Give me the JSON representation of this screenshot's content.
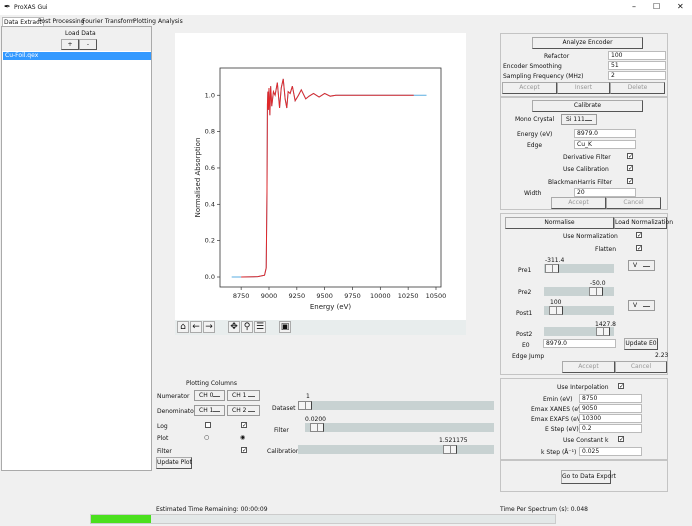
{
  "window": {
    "title": "ProXAS Gui",
    "minimize": "–",
    "maximize": "☐",
    "close": "✕"
  },
  "tabs": [
    {
      "label": "Data Extract"
    },
    {
      "label": "Post Processing"
    },
    {
      "label": "Fourier Transform"
    },
    {
      "label": "Plotting"
    },
    {
      "label": "Analysis"
    }
  ],
  "load": {
    "title": "Load Data",
    "add": "+",
    "remove": "-",
    "files": [
      "Cu-Foil.qex"
    ]
  },
  "toolbar": {
    "icons": [
      "home-icon",
      "back-icon",
      "forward-icon",
      "pan-icon",
      "zoom-icon",
      "configure-icon",
      "save-icon"
    ]
  },
  "chart_data": {
    "type": "line",
    "xlabel": "Energy (eV)",
    "ylabel": "Normalised Absorption",
    "xlim": [
      8560,
      10545
    ],
    "ylim": [
      -0.055,
      1.15
    ],
    "xticks": [
      8750,
      9000,
      9250,
      9500,
      9750,
      10000,
      10250,
      10500
    ],
    "yticks": [
      0.0,
      0.2,
      0.4,
      0.6,
      0.8,
      1.0
    ],
    "series": [
      {
        "color": "#5aaee0",
        "points": [
          [
            8665,
            0
          ],
          [
            8750,
            0
          ],
          [
            8900,
            0.002
          ],
          [
            8960,
            0.01
          ],
          [
            8975,
            0.05
          ],
          [
            8982,
            0.47
          ],
          [
            8986,
            0.95
          ],
          [
            8990,
            1.02
          ],
          [
            8995,
            0.92
          ],
          [
            9000,
            1.04
          ],
          [
            9008,
            0.89
          ],
          [
            9015,
            1.05
          ],
          [
            9025,
            0.94
          ],
          [
            9040,
            1.02
          ],
          [
            9055,
            1.0
          ],
          [
            9075,
            1.07
          ],
          [
            9095,
            0.93
          ],
          [
            9110,
            1.04
          ],
          [
            9128,
            1.09
          ],
          [
            9145,
            0.98
          ],
          [
            9160,
            0.93
          ],
          [
            9172,
            1.02
          ],
          [
            9190,
            1.01
          ],
          [
            9210,
            1.05
          ],
          [
            9235,
            0.97
          ],
          [
            9265,
            1.0
          ],
          [
            9290,
            1.03
          ],
          [
            9330,
            0.98
          ],
          [
            9360,
            0.995
          ],
          [
            9400,
            1.01
          ],
          [
            9450,
            0.99
          ],
          [
            9500,
            1.01
          ],
          [
            9550,
            0.995
          ],
          [
            9600,
            1.0
          ],
          [
            10300,
            1.0
          ],
          [
            10415,
            1.0
          ]
        ]
      },
      {
        "color": "#e0282a",
        "points": [
          [
            8750,
            0
          ],
          [
            8900,
            0.002
          ],
          [
            8960,
            0.01
          ],
          [
            8975,
            0.05
          ],
          [
            8982,
            0.47
          ],
          [
            8986,
            0.95
          ],
          [
            8990,
            1.02
          ],
          [
            8995,
            0.92
          ],
          [
            9000,
            1.04
          ],
          [
            9008,
            0.89
          ],
          [
            9015,
            1.05
          ],
          [
            9025,
            0.94
          ],
          [
            9040,
            1.02
          ],
          [
            9055,
            1.0
          ],
          [
            9075,
            1.07
          ],
          [
            9095,
            0.93
          ],
          [
            9110,
            1.04
          ],
          [
            9128,
            1.09
          ],
          [
            9145,
            0.98
          ],
          [
            9160,
            0.93
          ],
          [
            9172,
            1.02
          ],
          [
            9190,
            1.01
          ],
          [
            9210,
            1.05
          ],
          [
            9235,
            0.97
          ],
          [
            9265,
            1.0
          ],
          [
            9290,
            1.03
          ],
          [
            9330,
            0.98
          ],
          [
            9360,
            0.995
          ],
          [
            9400,
            1.01
          ],
          [
            9450,
            0.99
          ],
          [
            9500,
            1.01
          ],
          [
            9550,
            0.995
          ],
          [
            9600,
            1.0
          ],
          [
            9800,
            1.0
          ],
          [
            10300,
            1.0
          ]
        ]
      }
    ]
  },
  "plotting": {
    "title": "Plotting Columns",
    "numerator": "Numerator",
    "denominator": "Denominator",
    "num_a": "CH 0",
    "num_b": "CH 1",
    "den_a": "CH 1",
    "den_b": "CH 2",
    "log": "Log",
    "plot": "Plot",
    "filter": "Filter",
    "update": "Update Plot",
    "log_a": false,
    "log_b": true,
    "plot_a": false,
    "plot_b": true,
    "filter_b": true
  },
  "sliders": {
    "dataset": {
      "label": "Dataset",
      "value": "1",
      "fraction": 0.0
    },
    "filter": {
      "label": "Filter",
      "value": "0.0200",
      "fraction": 0.03
    },
    "calibration": {
      "label": "Calibration",
      "value": "1.521175",
      "fraction": 0.76
    }
  },
  "encoder": {
    "button": "Analyze Encoder",
    "refactor_label": "Refactor",
    "refactor": "100",
    "smoothing_label": "Encoder Smoothing",
    "smoothing": "51",
    "freq_label": "Sampling Frequency (MHz)",
    "freq": "2",
    "accept": "Accept",
    "insert": "Insert",
    "delete": "Delete"
  },
  "calibrate": {
    "button": "Calibrate",
    "mono_label": "Mono Crystal",
    "mono": "Si 111",
    "energy_label": "Energy (eV)",
    "energy": "8979.0",
    "edge_label": "Edge",
    "edge": "Cu_K",
    "derivative": "Derivative Filter",
    "use_cal": "Use Calibration",
    "blackman": "BlackmanHarris Filter",
    "width_label": "Width",
    "width": "20",
    "accept": "Accept",
    "cancel": "Cancel"
  },
  "normalise": {
    "button": "Normalise",
    "load": "Load Normalization",
    "use_norm": "Use Normalization",
    "flatten": "Flatten",
    "pre1": "Pre1",
    "pre1_val": "-311.4",
    "pre2": "Pre2",
    "pre2_val": "-50.0",
    "post1": "Post1",
    "post1_val": "100",
    "post2": "Post2",
    "post2_val": "1427.8",
    "order1": "V",
    "order2": "V",
    "e0_label": "E0",
    "e0": "8979.0",
    "update_e0": "Update E0",
    "edge_jump_label": "Edge Jump",
    "edge_jump": "2.23",
    "accept": "Accept",
    "cancel": "Cancel"
  },
  "interp": {
    "use": "Use Interpolation",
    "emin_label": "Emin (eV)",
    "emin": "8750",
    "xanes_label": "Emax XANES (eV)",
    "xanes": "9050",
    "exafs_label": "Emax EXAFS (eV)",
    "exafs": "10300",
    "estep_label": "E Step (eV)",
    "estep": "0.2",
    "constk": "Use Constant k",
    "kstep_label": "k Step (Å⁻¹)",
    "kstep": "0.025"
  },
  "export": "Go to Data Export",
  "status": {
    "remaining": "Estimated Time Remaining: 00:00:09",
    "per_spectrum": "Time Per Spectrum (s): 0.048",
    "progress": 0.13,
    "progress_color": "#4be01e"
  }
}
